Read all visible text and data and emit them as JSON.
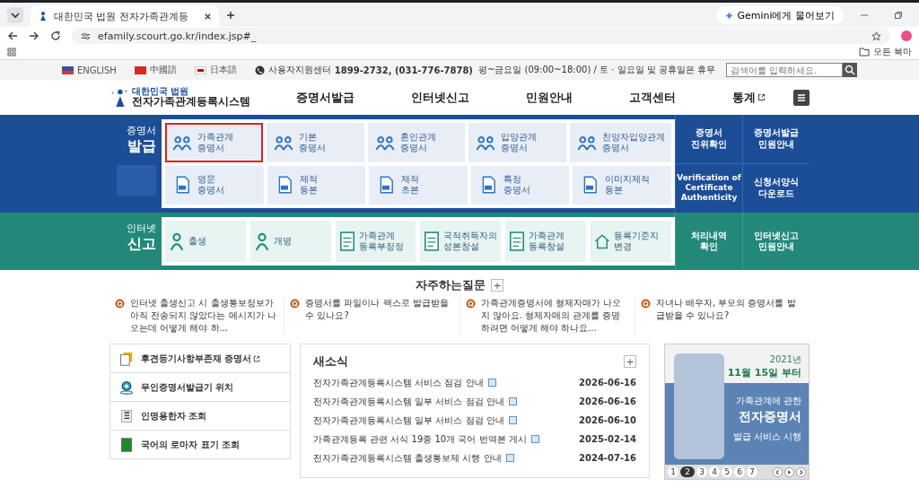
{
  "browser": {
    "tab_title": "대한민국 법원 전자가족관계등",
    "gemini_button": "Gemini에게 물어보기",
    "url": "efamily.scourt.go.kr/index.jsp#_",
    "bookmarks_label": "모든 북마"
  },
  "utility_bar": {
    "languages": [
      "ENGLISH",
      "中國語",
      "日本語"
    ],
    "support_label": "사용자지원센터",
    "support_numbers": "1899-2732, (031-776-7878)",
    "support_hours": "평~금요일 (09:00~18:00) / 토 · 일요일 및 공휴일은 휴무",
    "search": {
      "placeholder": "검색어를 입력하세요."
    }
  },
  "header": {
    "logo_top": "대한민국 법원",
    "logo_title": "전자가족관계등록시스템",
    "nav": [
      {
        "label": "증명서발급",
        "external": false
      },
      {
        "label": "인터넷신고",
        "external": false
      },
      {
        "label": "민원안내",
        "external": false
      },
      {
        "label": "고객센터",
        "external": false
      },
      {
        "label": "통계",
        "external": true
      }
    ]
  },
  "certificates": {
    "title_top": "증명서",
    "title_main": "발급",
    "rows": [
      [
        {
          "line1": "가족관계",
          "line2": "증명서",
          "selected": true
        },
        {
          "line1": "기본",
          "line2": "증명서",
          "selected": false
        },
        {
          "line1": "혼인관계",
          "line2": "증명서",
          "selected": false
        },
        {
          "line1": "입양관계",
          "line2": "증명서",
          "selected": false
        },
        {
          "line1": "친양자입양관계",
          "line2": "증명서",
          "selected": false
        }
      ],
      [
        {
          "line1": "영문",
          "line2": "증명서",
          "selected": false
        },
        {
          "line1": "제적",
          "line2": "등본",
          "selected": false
        },
        {
          "line1": "제적",
          "line2": "초본",
          "selected": false
        },
        {
          "line1": "특정",
          "line2": "증명서",
          "selected": false
        },
        {
          "line1": "이미지제적",
          "line2": "등본",
          "selected": false
        }
      ]
    ],
    "side_links": [
      [
        "증명서",
        "진위확인"
      ],
      [
        "증명서발급",
        "민원안내"
      ],
      [
        "Verification of",
        "Certificate",
        "Authenticity"
      ],
      [
        "신청서양식",
        "다운로드"
      ]
    ]
  },
  "reports": {
    "title_top": "인터넷",
    "title_main": "신고",
    "items": [
      [
        "출생"
      ],
      [
        "개명"
      ],
      [
        "가족관계",
        "등록부정정"
      ],
      [
        "국적취득자의",
        "성본창설"
      ],
      [
        "가족관계",
        "등록창설"
      ],
      [
        "등록기준지",
        "변경"
      ]
    ],
    "side_links": [
      [
        "처리내역",
        "확인"
      ],
      [
        "인터넷신고",
        "민원안내"
      ]
    ]
  },
  "faq": {
    "title": "자주하는질문",
    "more": "+",
    "items": [
      "인터넷 출생신고 시 출생통보정보가 아직 전송되지 않았다는 메시지가 나오는데 어떻게 해야 하...",
      "증명서를 파일이나 팩스로 발급받을 수 있나요?",
      "가족관계증명서에 형제자매가 나오지 않아요. 형제자매의 관계를 증명하려면 어떻게 해야 하나요...",
      "자녀나 배우자, 부모의 증명서를 발급받을 수 있나요?"
    ]
  },
  "quick_links": [
    {
      "label": "후견등기사항부존재 증명서",
      "external": true
    },
    {
      "label": "무인증명서발급기 위치",
      "external": false
    },
    {
      "label": "인명용한자 조회",
      "external": false
    },
    {
      "label": "국어의 로마자 표기 조회",
      "external": false
    }
  ],
  "news": {
    "title": "새소식",
    "more": "+",
    "items": [
      {
        "title": "전자가족관계등록시스템 서비스 점검 안내",
        "date": "2026-06-16"
      },
      {
        "title": "전자가족관계등록시스템 일부 서비스 점검 안내",
        "date": "2026-06-16"
      },
      {
        "title": "전자가족관계등록시스템 일부 서비스 점검 안내",
        "date": "2026-06-10"
      },
      {
        "title": "가족관계등록 관련 서식 19종 10개 국어 번역본 게시",
        "date": "2025-02-14"
      },
      {
        "title": "전자가족관계등록시스템 출생통보제 시행 안내",
        "date": "2024-07-16"
      }
    ]
  },
  "banner": {
    "year": "2021년",
    "date": "11월 15일 부터",
    "line1": "가족관계에 관한",
    "line2": "전자증명서",
    "line3": "발급 서비스 시행",
    "pages": [
      {
        "label": "1",
        "selected": false
      },
      {
        "label": "2",
        "selected": true
      },
      {
        "label": "3",
        "selected": false
      },
      {
        "label": "4",
        "selected": false
      },
      {
        "label": "5",
        "selected": false
      },
      {
        "label": "6",
        "selected": false
      },
      {
        "label": "7",
        "selected": false
      }
    ]
  }
}
